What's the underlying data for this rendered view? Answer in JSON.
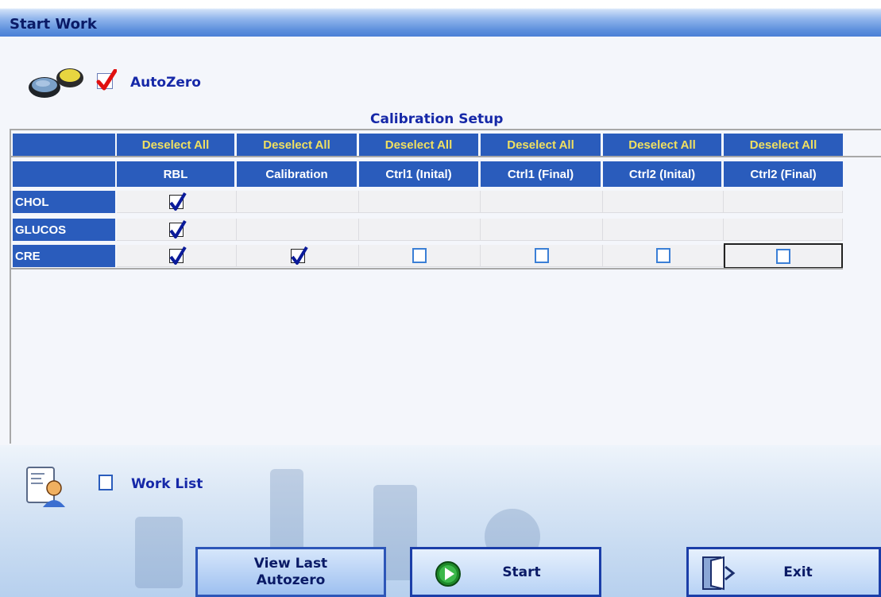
{
  "window": {
    "title": "Start Work"
  },
  "autozero": {
    "label": "AutoZero",
    "checked": true,
    "icon": "lens-filters-icon"
  },
  "calibration": {
    "title": "Calibration Setup",
    "deselect_labels": [
      "Deselect All",
      "Deselect All",
      "Deselect All",
      "Deselect All",
      "Deselect All",
      "Deselect All"
    ],
    "columns": [
      "RBL",
      "Calibration",
      "Ctrl1 (Inital)",
      "Ctrl1 (Final)",
      "Ctrl2 (Inital)",
      "Ctrl2 (Final)"
    ],
    "rows": [
      {
        "name": "CHOL",
        "cells": [
          "checked",
          "none",
          "none",
          "none",
          "none",
          "none"
        ]
      },
      {
        "name": "GLUCOS",
        "cells": [
          "checked",
          "none",
          "none",
          "none",
          "none",
          "none"
        ]
      },
      {
        "name": "CRE",
        "cells": [
          "checked",
          "checked",
          "unchecked",
          "unchecked",
          "unchecked",
          "unchecked"
        ]
      }
    ]
  },
  "worklist": {
    "label": "Work List",
    "checked": false,
    "icon": "worklist-user-icon"
  },
  "buttons": {
    "view_last_line1": "View Last",
    "view_last_line2": "Autozero",
    "start": "Start",
    "exit": "Exit"
  },
  "colors": {
    "header_blue": "#2a5cbc",
    "deselect_text": "#f0e060",
    "label_blue": "#1628a8"
  }
}
